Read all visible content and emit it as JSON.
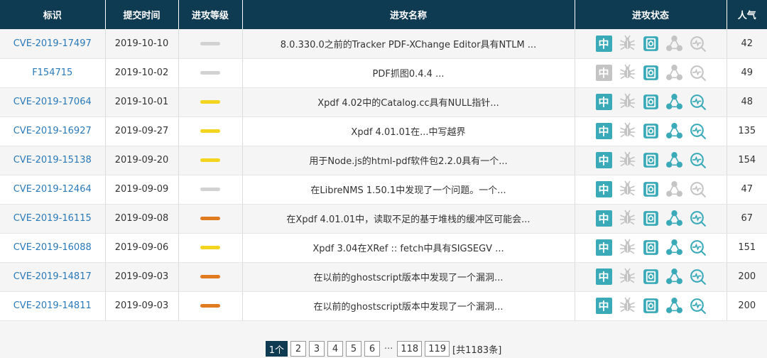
{
  "table": {
    "headers": [
      "标识",
      "提交时间",
      "进攻等级",
      "进攻名称",
      "进攻状态",
      "人气"
    ],
    "rows": [
      {
        "id": "CVE-2019-17497",
        "date": "2019-10-10",
        "level": "gray",
        "name": "8.0.330.0之前的Tracker PDF-XChange Editor具有NTLM ...",
        "popularity": "42",
        "status": {
          "zh": true,
          "bug": false,
          "doc": true,
          "share": false,
          "scan": false
        }
      },
      {
        "id": "F154715",
        "date": "2019-10-02",
        "level": "gray",
        "name": "PDF抓图0.4.4 ...",
        "popularity": "49",
        "status": {
          "zh": false,
          "bug": false,
          "doc": true,
          "share": false,
          "scan": false
        }
      },
      {
        "id": "CVE-2019-17064",
        "date": "2019-10-01",
        "level": "yellow",
        "name": "Xpdf 4.02中的Catalog.cc具有NULL指针...",
        "popularity": "48",
        "status": {
          "zh": true,
          "bug": false,
          "doc": true,
          "share": true,
          "scan": true
        }
      },
      {
        "id": "CVE-2019-16927",
        "date": "2019-09-27",
        "level": "yellow",
        "name": "Xpdf 4.01.01在...中写越界",
        "popularity": "135",
        "status": {
          "zh": true,
          "bug": false,
          "doc": true,
          "share": true,
          "scan": true
        }
      },
      {
        "id": "CVE-2019-15138",
        "date": "2019-09-20",
        "level": "yellow",
        "name": "用于Node.js的html-pdf软件包2.2.0具有一个...",
        "popularity": "154",
        "status": {
          "zh": true,
          "bug": false,
          "doc": true,
          "share": true,
          "scan": true
        }
      },
      {
        "id": "CVE-2019-12464",
        "date": "2019-09-09",
        "level": "gray",
        "name": "在LibreNMS 1.50.1中发现了一个问题。一个...",
        "popularity": "47",
        "status": {
          "zh": true,
          "bug": false,
          "doc": true,
          "share": false,
          "scan": false
        }
      },
      {
        "id": "CVE-2019-16115",
        "date": "2019-09-08",
        "level": "orange",
        "name": "在Xpdf 4.01.01中，读取不足的基于堆栈的缓冲区可能会...",
        "popularity": "67",
        "status": {
          "zh": true,
          "bug": false,
          "doc": true,
          "share": true,
          "scan": true
        }
      },
      {
        "id": "CVE-2019-16088",
        "date": "2019-09-06",
        "level": "yellow",
        "name": "Xpdf 3.04在XRef :: fetch中具有SIGSEGV ...",
        "popularity": "151",
        "status": {
          "zh": true,
          "bug": false,
          "doc": true,
          "share": true,
          "scan": true
        }
      },
      {
        "id": "CVE-2019-14817",
        "date": "2019-09-03",
        "level": "orange",
        "name": "在以前的ghostscript版本中发现了一个漏洞...",
        "popularity": "200",
        "status": {
          "zh": true,
          "bug": false,
          "doc": true,
          "share": true,
          "scan": true
        }
      },
      {
        "id": "CVE-2019-14811",
        "date": "2019-09-03",
        "level": "orange",
        "name": "在以前的ghostscript版本中发现了一个漏洞...",
        "popularity": "200",
        "status": {
          "zh": true,
          "bug": false,
          "doc": true,
          "share": true,
          "scan": true
        }
      }
    ]
  },
  "status_zh_glyph": "中",
  "colors": {
    "header_bg": "#0e3a52",
    "active": "#3aaab8",
    "inactive": "#c4c4c4",
    "level_gray": "#d2d2d2",
    "level_yellow": "#f3d51f",
    "level_orange": "#e07b20"
  },
  "icons": [
    "chinese-badge-icon",
    "bug-icon",
    "document-icon",
    "share-nodes-icon",
    "scan-search-icon"
  ],
  "pagination": {
    "pages": [
      "1个",
      "2",
      "3",
      "4",
      "5",
      "6"
    ],
    "ellipsis": "···",
    "tail_pages": [
      "118",
      "119"
    ],
    "total": "[共1183条]"
  }
}
